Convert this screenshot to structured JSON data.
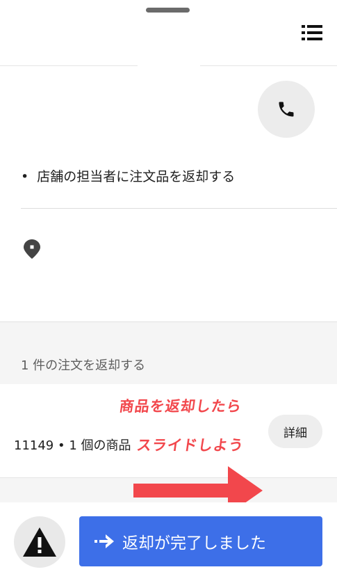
{
  "header": {
    "menu_icon": "list-icon",
    "handle": "drag-handle"
  },
  "contact": {
    "phone_icon": "phone-icon"
  },
  "instruction": {
    "bullet": "•",
    "text": "店舗の担当者に注文品を返却する"
  },
  "location": {
    "icon": "map-pin-icon"
  },
  "section": {
    "title": "1 件の注文を返却する"
  },
  "order": {
    "summary": "11149 • 1 個の商品",
    "detail_label": "詳細"
  },
  "annotation": {
    "line1": "商品を返却したら",
    "line2": "スライドしよう",
    "color": "#f2474c"
  },
  "footer": {
    "warning_icon": "warning-icon",
    "complete_label": "返却が完了しました",
    "complete_color": "#3d6fe8"
  }
}
